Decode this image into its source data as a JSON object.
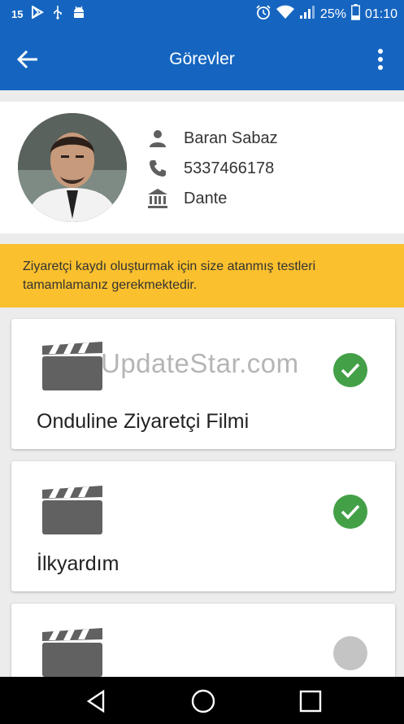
{
  "status_bar": {
    "notification_count": "15",
    "battery_percent": "25%",
    "time": "01:10",
    "icons": [
      "play-store-icon",
      "usb-icon",
      "android-debug-icon",
      "alarm-icon",
      "wifi-icon",
      "signal-icon",
      "battery-icon"
    ]
  },
  "app_bar": {
    "title": "Görevler",
    "back_icon": "arrow-back-icon",
    "menu_icon": "more-vert-icon"
  },
  "profile": {
    "name": "Baran Sabaz",
    "phone": "5337466178",
    "company": "Dante"
  },
  "warning": {
    "text": "Ziyaretçi kaydı oluşturmak için size atanmış testleri tamamlamanız gerekmektedir."
  },
  "watermark": "UpdateStar.com",
  "tasks": [
    {
      "title": "Onduline Ziyaretçi Filmi",
      "status": "completed"
    },
    {
      "title": "İlkyardım",
      "status": "completed"
    },
    {
      "title": "",
      "status": "pending"
    }
  ],
  "colors": {
    "primary": "#1565c0",
    "warning": "#fbc02d",
    "done": "#43a047",
    "pending": "#c4c4c4"
  },
  "nav": [
    "back-nav-icon",
    "home-nav-icon",
    "recents-nav-icon"
  ]
}
